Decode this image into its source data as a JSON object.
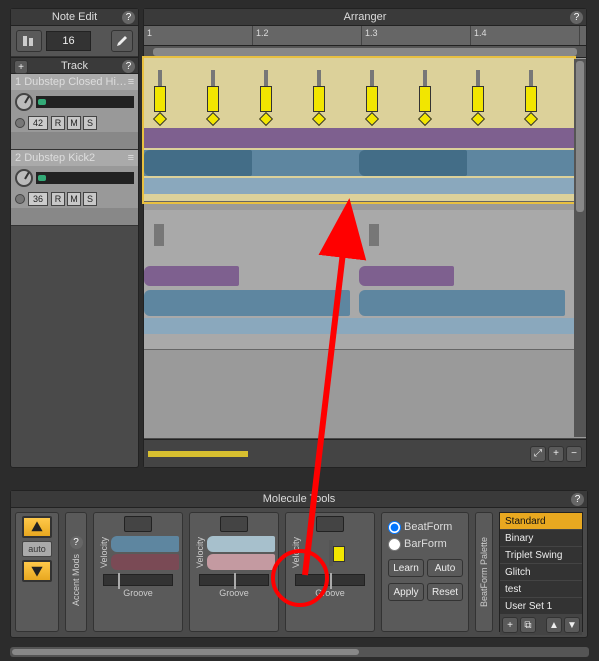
{
  "noteEdit": {
    "title": "Note Edit",
    "value": "16",
    "trackHeader": "Track"
  },
  "tracks": [
    {
      "index": "1",
      "name": "Dubstep Closed Hi-…",
      "num": "42",
      "r": "R",
      "m": "M",
      "s": "S"
    },
    {
      "index": "2",
      "name": "Dubstep Kick2",
      "num": "36",
      "r": "R",
      "m": "M",
      "s": "S"
    }
  ],
  "arranger": {
    "title": "Arranger",
    "ruler": [
      "1",
      "1.2",
      "1.3",
      "1.4"
    ]
  },
  "mol": {
    "title": "Molecule Tools",
    "accentLabel": "Accent Mods",
    "auto": "auto",
    "slots": [
      {
        "velocity": "Velocity",
        "groove": "Groove",
        "c1": "#5e86a0",
        "c2": "#7a4a55"
      },
      {
        "velocity": "Velocity",
        "groove": "Groove",
        "c1": "#a7c0cc",
        "c2": "#c49aa1"
      },
      {
        "velocity": "Velocity",
        "groove": "Groove",
        "c1": "#f2e600",
        "c2": "#777"
      }
    ],
    "radios": {
      "beat": "BeatForm",
      "bar": "BarForm"
    },
    "buttons": {
      "learn": "Learn",
      "auto": "Auto",
      "apply": "Apply",
      "reset": "Reset"
    },
    "paletteLabel": "BeatForm Palette",
    "palette": [
      "Standard",
      "Binary",
      "Triplet Swing",
      "Glitch",
      "test",
      "User Set 1"
    ]
  },
  "colors": {
    "accent": "#e8a820",
    "yellow": "#f2e600",
    "purple": "#7e608f",
    "blue": "#5e86a0",
    "red": "#ff0000"
  }
}
